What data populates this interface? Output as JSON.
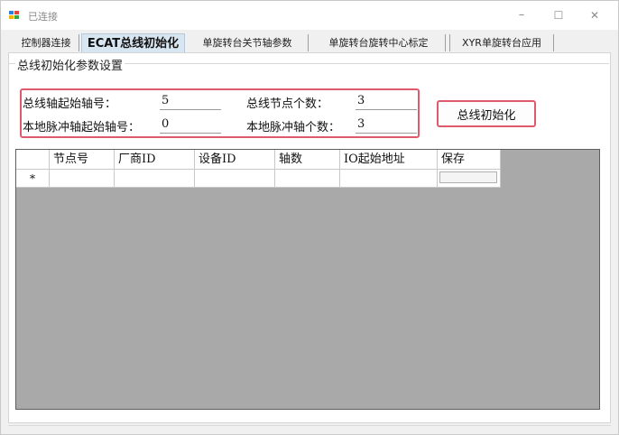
{
  "window": {
    "title": "已连接",
    "controls": {
      "minimize": "–",
      "maximize": "☐",
      "close": "✕"
    }
  },
  "tabs": [
    {
      "label": "控制器连接",
      "active": false
    },
    {
      "label": "ECAT总线初始化",
      "active": true
    },
    {
      "label": "单旋转台关节轴参数",
      "active": false
    },
    {
      "label": "单旋转台旋转中心标定",
      "active": false
    },
    {
      "label": "XYR单旋转台应用",
      "active": false
    }
  ],
  "group": {
    "title": "总线初始化参数设置",
    "bus_start_axis_label": "总线轴起始轴号：",
    "bus_start_axis_value": "5",
    "bus_node_count_label": "总线节点个数：",
    "bus_node_count_value": "3",
    "local_pulse_start_label": "本地脉冲轴起始轴号：",
    "local_pulse_start_value": "0",
    "local_pulse_count_label": "本地脉冲轴个数：",
    "local_pulse_count_value": "3",
    "init_button": "总线初始化"
  },
  "table": {
    "columns": [
      "节点号",
      "厂商ID",
      "设备ID",
      "轴数",
      "IO起始地址",
      "保存"
    ],
    "new_row_marker": "*"
  },
  "colors": {
    "highlight_border": "#e05a6d",
    "active_tab": "#d8e6f2",
    "grid_background": "#a9a9a9"
  }
}
